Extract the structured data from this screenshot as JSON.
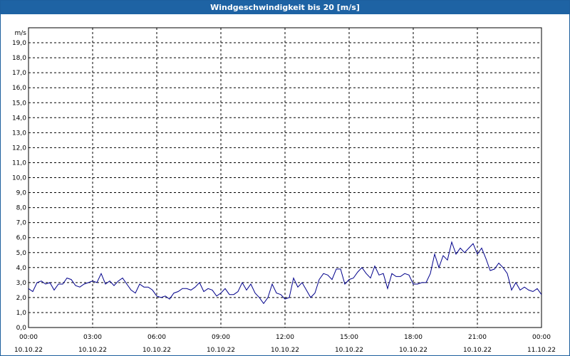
{
  "window": {
    "title": "Windgeschwindigkeit bis 20 [m/s]"
  },
  "chart_data": {
    "type": "line",
    "title": "Windgeschwindigkeit bis 20 [m/s]",
    "ylabel": "m/s",
    "xlabel": "",
    "ylim": [
      0,
      20
    ],
    "xlim_hours": [
      0,
      24
    ],
    "grid": true,
    "line_color": "#00008b",
    "y_ticks": [
      "0,0",
      "1,0",
      "2,0",
      "3,0",
      "4,0",
      "5,0",
      "6,0",
      "7,0",
      "8,0",
      "9,0",
      "10,0",
      "11,0",
      "12,0",
      "13,0",
      "14,0",
      "15,0",
      "16,0",
      "17,0",
      "18,0",
      "19,0"
    ],
    "x_ticks": [
      {
        "time": "00:00",
        "date": "10.10.22"
      },
      {
        "time": "03:00",
        "date": "10.10.22"
      },
      {
        "time": "06:00",
        "date": "10.10.22"
      },
      {
        "time": "09:00",
        "date": "10.10.22"
      },
      {
        "time": "12:00",
        "date": "10.10.22"
      },
      {
        "time": "15:00",
        "date": "10.10.22"
      },
      {
        "time": "18:00",
        "date": "10.10.22"
      },
      {
        "time": "21:00",
        "date": "10.10.22"
      },
      {
        "time": "00:00",
        "date": "11.10.22"
      }
    ],
    "series": [
      {
        "x_hours": [
          0,
          0.2,
          0.4,
          0.6,
          0.8,
          1.0,
          1.2,
          1.4,
          1.6,
          1.8,
          2.0,
          2.2,
          2.4,
          2.6,
          2.8,
          3.0,
          3.2,
          3.4,
          3.6,
          3.8,
          4.0,
          4.2,
          4.4,
          4.6,
          4.8,
          5.0,
          5.2,
          5.4,
          5.6,
          5.8,
          6.0,
          6.2,
          6.4,
          6.6,
          6.8,
          7.0,
          7.2,
          7.4,
          7.6,
          7.8,
          8.0,
          8.2,
          8.4,
          8.6,
          8.8,
          9.0,
          9.2,
          9.4,
          9.6,
          9.8,
          10.0,
          10.2,
          10.4,
          10.6,
          10.8,
          11.0,
          11.2,
          11.4,
          11.6,
          11.8,
          12.0,
          12.2,
          12.4,
          12.6,
          12.8,
          13.0,
          13.2,
          13.4,
          13.6,
          13.8,
          14.0,
          14.2,
          14.4,
          14.6,
          14.8,
          15.0,
          15.2,
          15.4,
          15.6,
          15.8,
          16.0,
          16.2,
          16.4,
          16.6,
          16.8,
          17.0,
          17.2,
          17.4,
          17.6,
          17.8,
          18.0,
          18.2,
          18.4,
          18.6,
          18.8,
          19.0,
          19.2,
          19.4,
          19.6,
          19.8,
          20.0,
          20.2,
          20.4,
          20.6,
          20.8,
          21.0,
          21.2,
          21.4,
          21.6,
          21.8,
          22.0,
          22.2,
          22.4,
          22.6,
          22.8,
          23.0,
          23.2,
          23.4,
          23.6,
          23.8,
          24.0
        ],
        "values": [
          2.6,
          2.4,
          3.0,
          3.1,
          2.9,
          3.0,
          2.5,
          2.9,
          2.9,
          3.3,
          3.2,
          2.8,
          2.7,
          2.9,
          3.0,
          3.1,
          3.0,
          3.6,
          2.9,
          3.1,
          2.8,
          3.1,
          3.3,
          2.9,
          2.5,
          2.3,
          2.9,
          2.7,
          2.7,
          2.5,
          2.1,
          2.0,
          2.1,
          1.9,
          2.3,
          2.4,
          2.6,
          2.6,
          2.5,
          2.7,
          3.0,
          2.4,
          2.6,
          2.5,
          2.1,
          2.3,
          2.6,
          2.2,
          2.2,
          2.4,
          3.0,
          2.5,
          2.9,
          2.3,
          2.0,
          1.6,
          2.0,
          2.9,
          2.3,
          2.2,
          1.9,
          2.0,
          3.3,
          2.7,
          3.0,
          2.5,
          2.0,
          2.3,
          3.2,
          3.6,
          3.5,
          3.2,
          3.9,
          3.9,
          2.9,
          3.2,
          3.3,
          3.7,
          4.0,
          3.6,
          3.3,
          4.1,
          3.5,
          3.6,
          2.6,
          3.6,
          3.4,
          3.4,
          3.6,
          3.5,
          2.9,
          2.9,
          3.0,
          3.0,
          3.6,
          4.9,
          4.0,
          4.8,
          4.5,
          5.7,
          4.9,
          5.3,
          5.0,
          5.3,
          5.6,
          4.9,
          5.3,
          4.6,
          3.8,
          3.9,
          4.3,
          4.0,
          3.6,
          2.5,
          3.0,
          2.5,
          2.7,
          2.5,
          2.4,
          2.6,
          2.2
        ]
      }
    ]
  }
}
